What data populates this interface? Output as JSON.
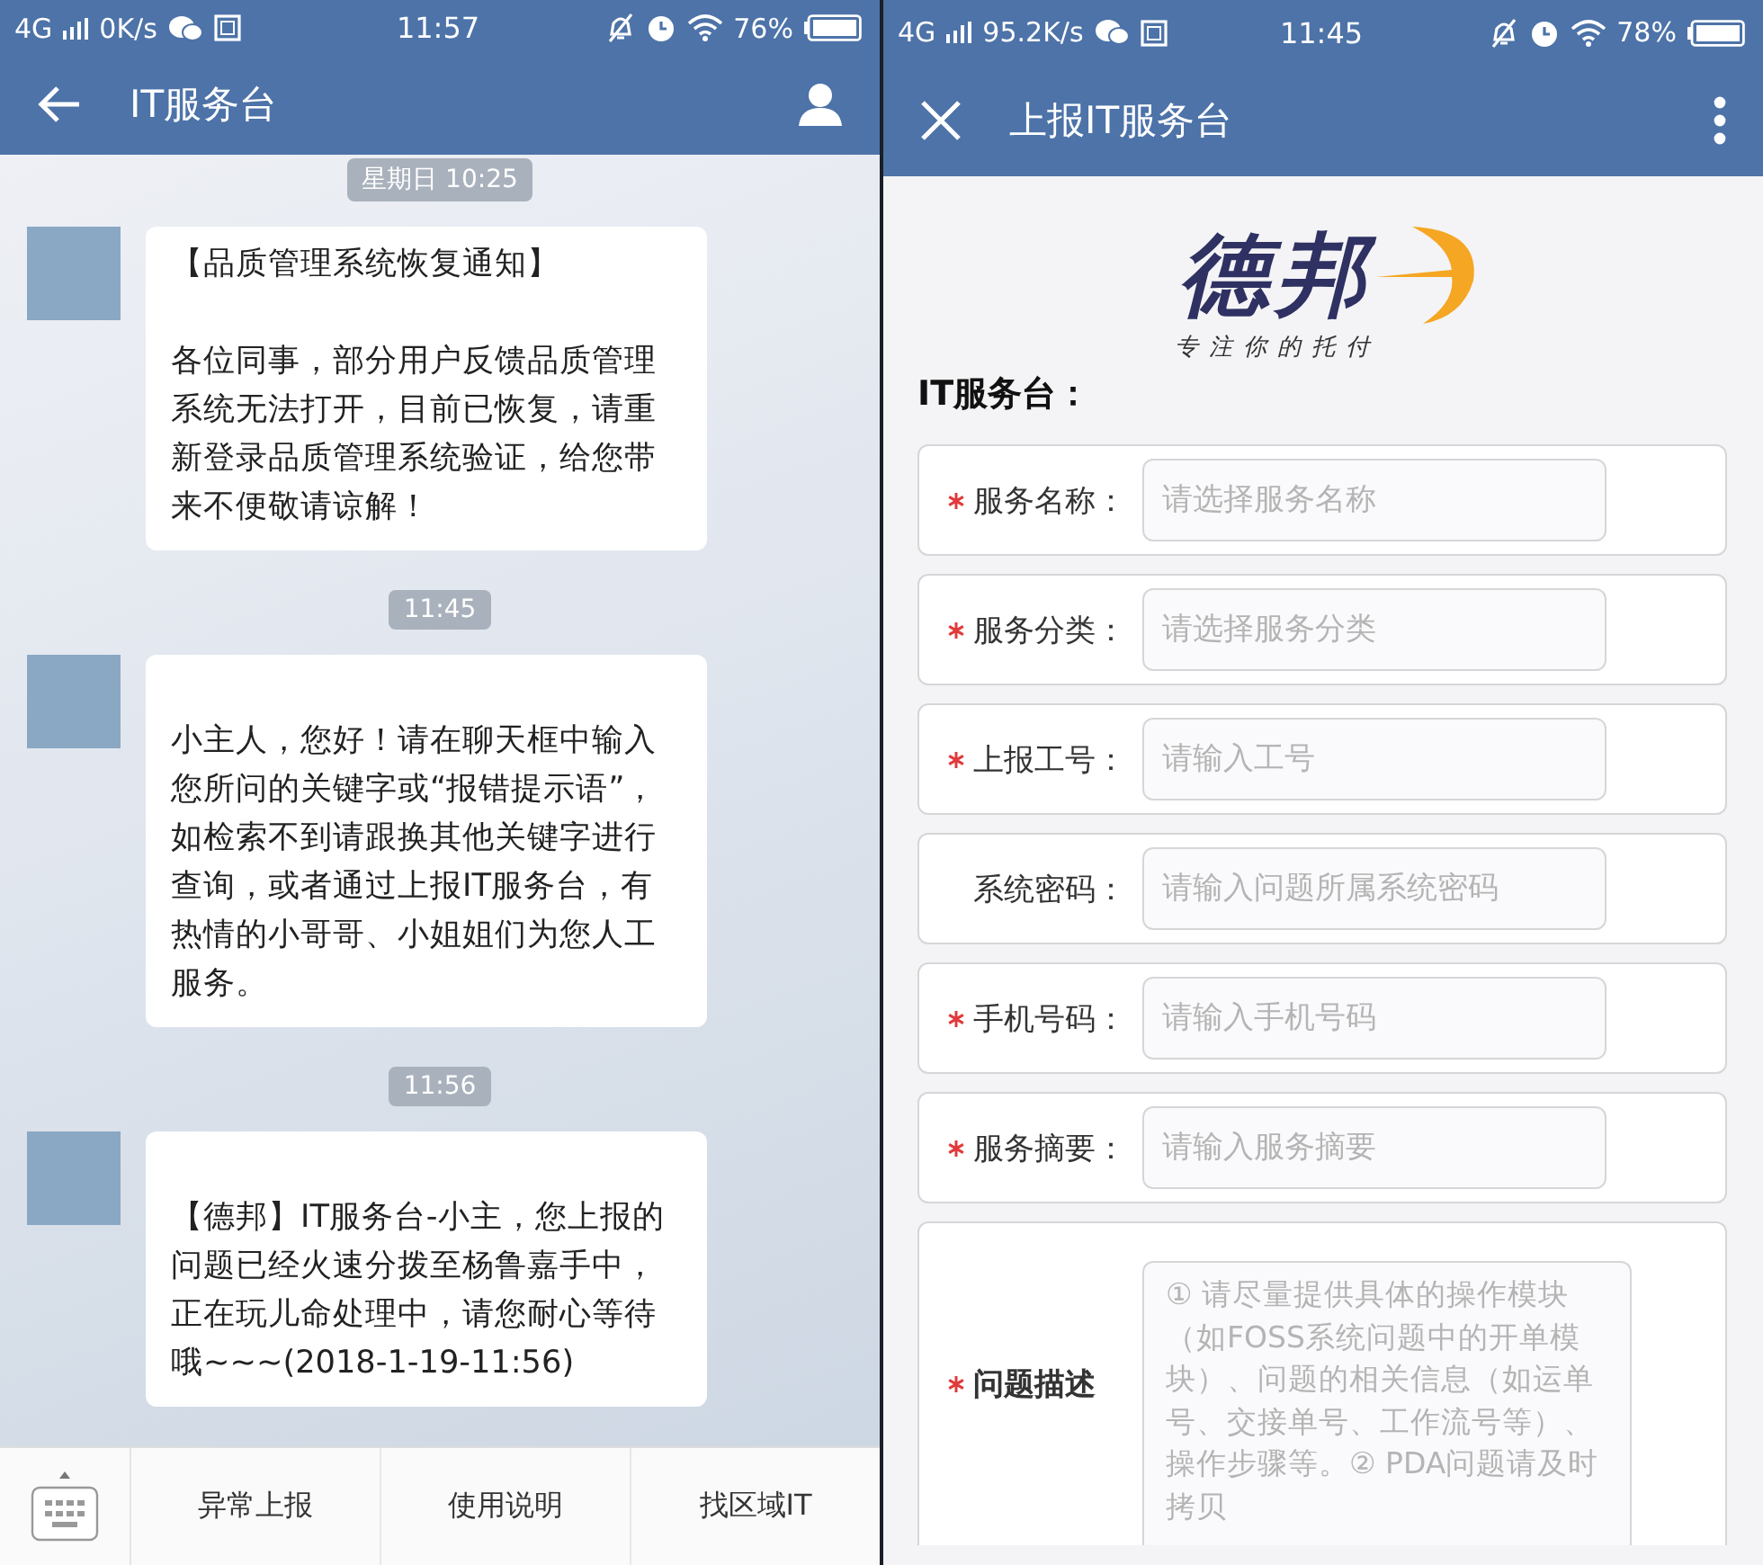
{
  "chat_screen": {
    "status_bar": {
      "network": "4G",
      "speed": "0K/s",
      "time": "11:57",
      "battery": "76%"
    },
    "header": {
      "title": "IT服务台"
    },
    "feed": [
      {
        "kind": "time",
        "text": "星期日 10:25"
      },
      {
        "kind": "message",
        "heading": "【品质管理系统恢复通知】",
        "text": "各位同事，部分用户反馈品质管理系统无法打开，目前已恢复，请重新登录品质管理系统验证，给您带来不便敬请谅解！"
      },
      {
        "kind": "time",
        "text": "11:45"
      },
      {
        "kind": "message",
        "text": "小主人，您好！请在聊天框中输入您所问的关键字或“报错提示语”，如检索不到请跟换其他关键字进行查询，或者通过上报IT服务台，有热情的小哥哥、小姐姐们为您人工服务。"
      },
      {
        "kind": "time",
        "text": "11:56"
      },
      {
        "kind": "message",
        "text": "【德邦】IT服务台-小主，您上报的问题已经火速分拨至杨鲁嘉手中，正在玩儿命处理中，请您耐心等待哦~~~(2018-1-19-11:56)"
      }
    ],
    "menu": [
      "异常上报",
      "使用说明",
      "找区域IT"
    ]
  },
  "form_screen": {
    "status_bar": {
      "network": "4G",
      "speed": "95.2K/s",
      "time": "11:45",
      "battery": "78%"
    },
    "header": {
      "title": "上报IT服务台"
    },
    "logo": {
      "name": "德邦",
      "slogan": "专注你的托付"
    },
    "section_title": "IT服务台：",
    "fields": [
      {
        "kind": "input",
        "label": "服务名称：",
        "placeholder": "请选择服务名称",
        "required": true
      },
      {
        "kind": "input",
        "label": "服务分类：",
        "placeholder": "请选择服务分类",
        "required": true
      },
      {
        "kind": "input",
        "label": "上报工号：",
        "placeholder": "请输入工号",
        "required": true
      },
      {
        "kind": "input",
        "label": "系统密码：",
        "placeholder": "请输入问题所属系统密码",
        "required": false
      },
      {
        "kind": "input",
        "label": "手机号码：",
        "placeholder": "请输入手机号码",
        "required": true
      },
      {
        "kind": "input",
        "label": "服务摘要：",
        "placeholder": "请输入服务摘要",
        "required": true
      },
      {
        "kind": "textarea",
        "label": "问题描述",
        "placeholder": "① 请尽量提供具体的操作模块（如FOSS系统问题中的开单模块）、问题的相关信息（如运单号、交接单号、工作流号等）、操作步骤等。② PDA问题请及时拷贝",
        "required": true
      }
    ]
  }
}
